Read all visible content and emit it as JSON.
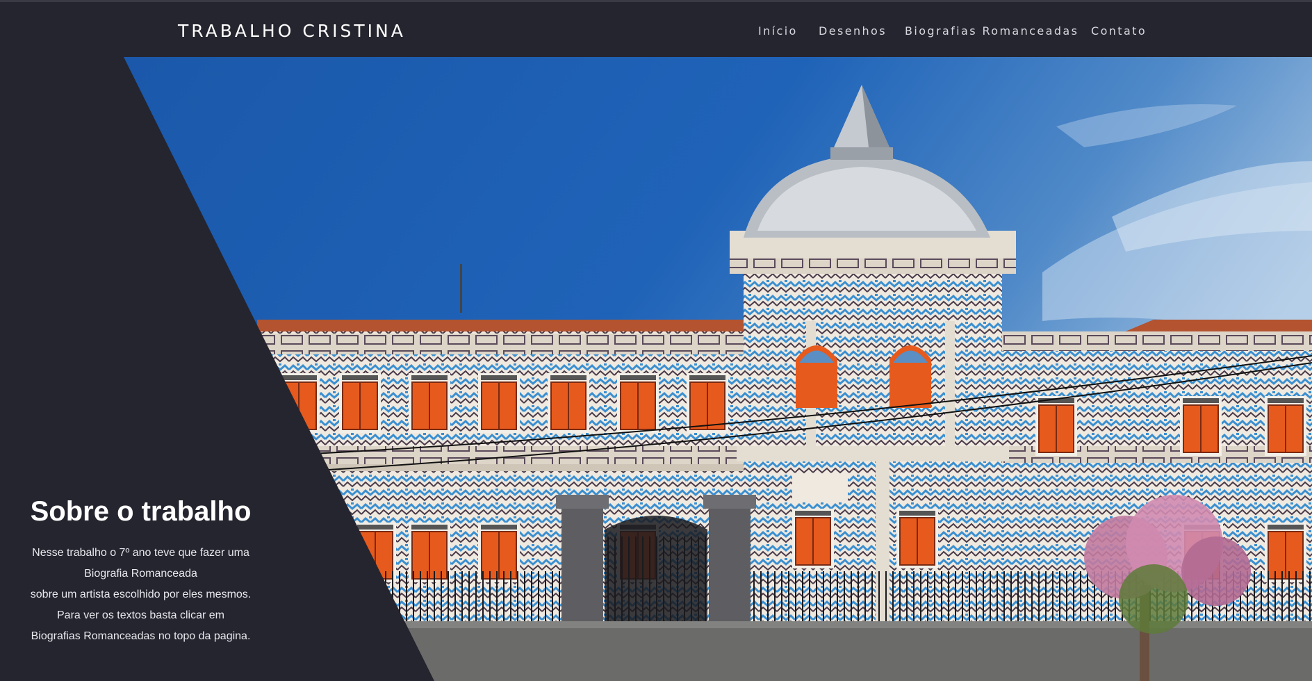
{
  "site": {
    "brand": "TRABALHO CRISTINA"
  },
  "nav": {
    "items": [
      "Início",
      "Desenhos",
      "Biografias Romanceadas",
      "Contato"
    ]
  },
  "hero": {
    "title": "Sobre o trabalho",
    "body_lines": [
      "Nesse trabalho o 7º ano teve que fazer uma",
      "Biografia Romanceada",
      "sobre um artista escolhido por eles mesmos.",
      "Para ver os textos basta clicar em",
      "Biografias Romanceadas no topo da pagina."
    ]
  },
  "colors": {
    "background": "#25252f",
    "sky": "#1f5fb0",
    "roof": "#b3532f",
    "shutters": "#e65a1d",
    "tile_blue": "#3a8fd0",
    "facade": "#efe9e0"
  },
  "icons": {
    "hero_image": "building-photo"
  }
}
